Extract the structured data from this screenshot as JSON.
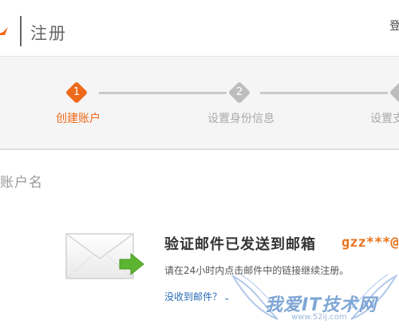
{
  "header": {
    "title": "注册",
    "right_text": "登"
  },
  "steps": [
    {
      "num": "1",
      "label": "创建账户",
      "active": true
    },
    {
      "num": "2",
      "label": "设置身份信息",
      "active": false
    },
    {
      "num": "",
      "label": "设置支",
      "active": false
    }
  ],
  "form": {
    "field_label": "账户名"
  },
  "mail_notice": {
    "title": "验证邮件已发送到邮箱",
    "address": "gzz***@",
    "hint": "请在24小时内点击邮件中的链接继续注册。",
    "not_received": "没收到邮件？"
  },
  "watermark": {
    "text": "我爱IT技术网",
    "url": "www.52ij.com"
  },
  "colors": {
    "accent": "#ee6a1a",
    "link": "#2a6bb5",
    "inactive": "#bdbdbd"
  }
}
